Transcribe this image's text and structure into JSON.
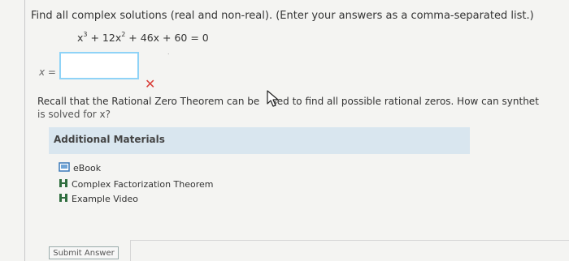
{
  "question": {
    "prompt": "Find all complex solutions (real and non-real). (Enter your answers as a comma-separated list.)",
    "equation": {
      "t1": "x",
      "e1": "3",
      "t2": " + 12x",
      "e2": "2",
      "t3": " + 46x + 60 = 0"
    }
  },
  "answer": {
    "label": "x =",
    "value": "",
    "status": "incorrect"
  },
  "hint": {
    "line1_a": "Recall that the Rational Zero Theorem can be",
    "line1_b": "sed to find all possible rational zeros. How can synthet",
    "line2": "is solved for x?"
  },
  "materials": {
    "title": "Additional Materials",
    "items": [
      {
        "label": "eBook",
        "icon": "book-icon"
      },
      {
        "label": "Complex Factorization Theorem",
        "icon": "document-icon"
      },
      {
        "label": "Example Video",
        "icon": "document-icon"
      }
    ]
  },
  "submit": {
    "label": "Submit Answer"
  },
  "colors": {
    "input_border": "#8fd3f7",
    "wrong": "#d9403b",
    "materials_header": "#d9e6ef",
    "book_icon": "#3a78b8",
    "doc_icon": "#2f6d3e"
  }
}
